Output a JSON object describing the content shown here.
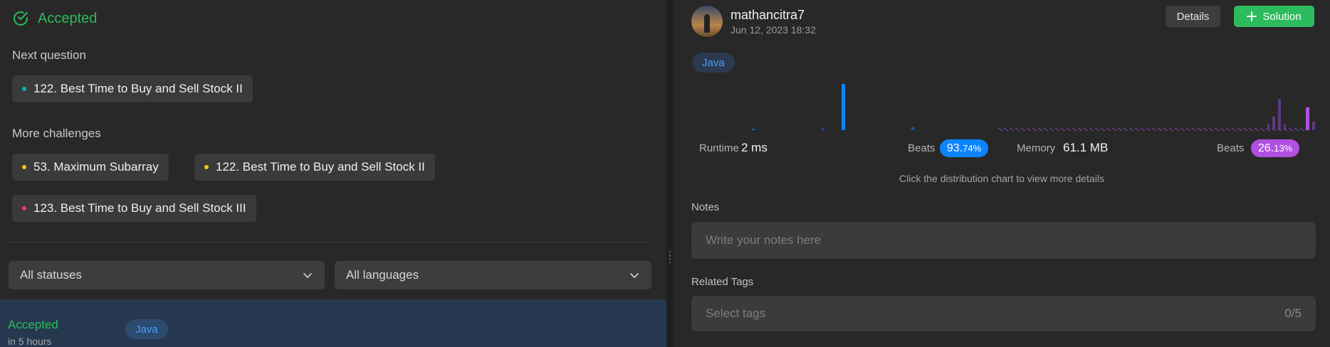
{
  "left": {
    "status_title": "Accepted",
    "next_question_label": "Next question",
    "next_question": {
      "title": "122. Best Time to Buy and Sell Stock II",
      "color": "#00b8a3"
    },
    "more_challenges_label": "More challenges",
    "challenges": [
      {
        "title": "53. Maximum Subarray",
        "color": "#ffc01e"
      },
      {
        "title": "122. Best Time to Buy and Sell Stock II",
        "color": "#ffc01e"
      },
      {
        "title": "123. Best Time to Buy and Sell Stock III",
        "color": "#ff375f"
      }
    ],
    "filters": {
      "status": "All statuses",
      "language": "All languages"
    },
    "submission": {
      "status": "Accepted",
      "time": "in 5 hours",
      "language": "Java"
    }
  },
  "right": {
    "user": {
      "name": "mathancitra7",
      "date": "Jun 12, 2023 18:32"
    },
    "buttons": {
      "details": "Details",
      "solution": "Solution"
    },
    "language": "Java",
    "runtime": {
      "label": "Runtime",
      "value": "2 ms",
      "beats_label": "Beats",
      "beats_int": "93.",
      "beats_dec": "74%",
      "color": "#0a84ff"
    },
    "memory": {
      "label": "Memory",
      "value": "61.1 MB",
      "beats_label": "Beats",
      "beats_int": "26.",
      "beats_dec": "13%",
      "color": "#b050e0"
    },
    "hint": "Click the distribution chart to view more details",
    "notes": {
      "label": "Notes",
      "placeholder": "Write your notes here"
    },
    "tags": {
      "label": "Related Tags",
      "placeholder": "Select tags",
      "count": "0/5"
    }
  },
  "colors": {
    "accepted": "#2cbb5d",
    "accent_blue": "#0a84ff",
    "accent_purple": "#b050e0"
  }
}
